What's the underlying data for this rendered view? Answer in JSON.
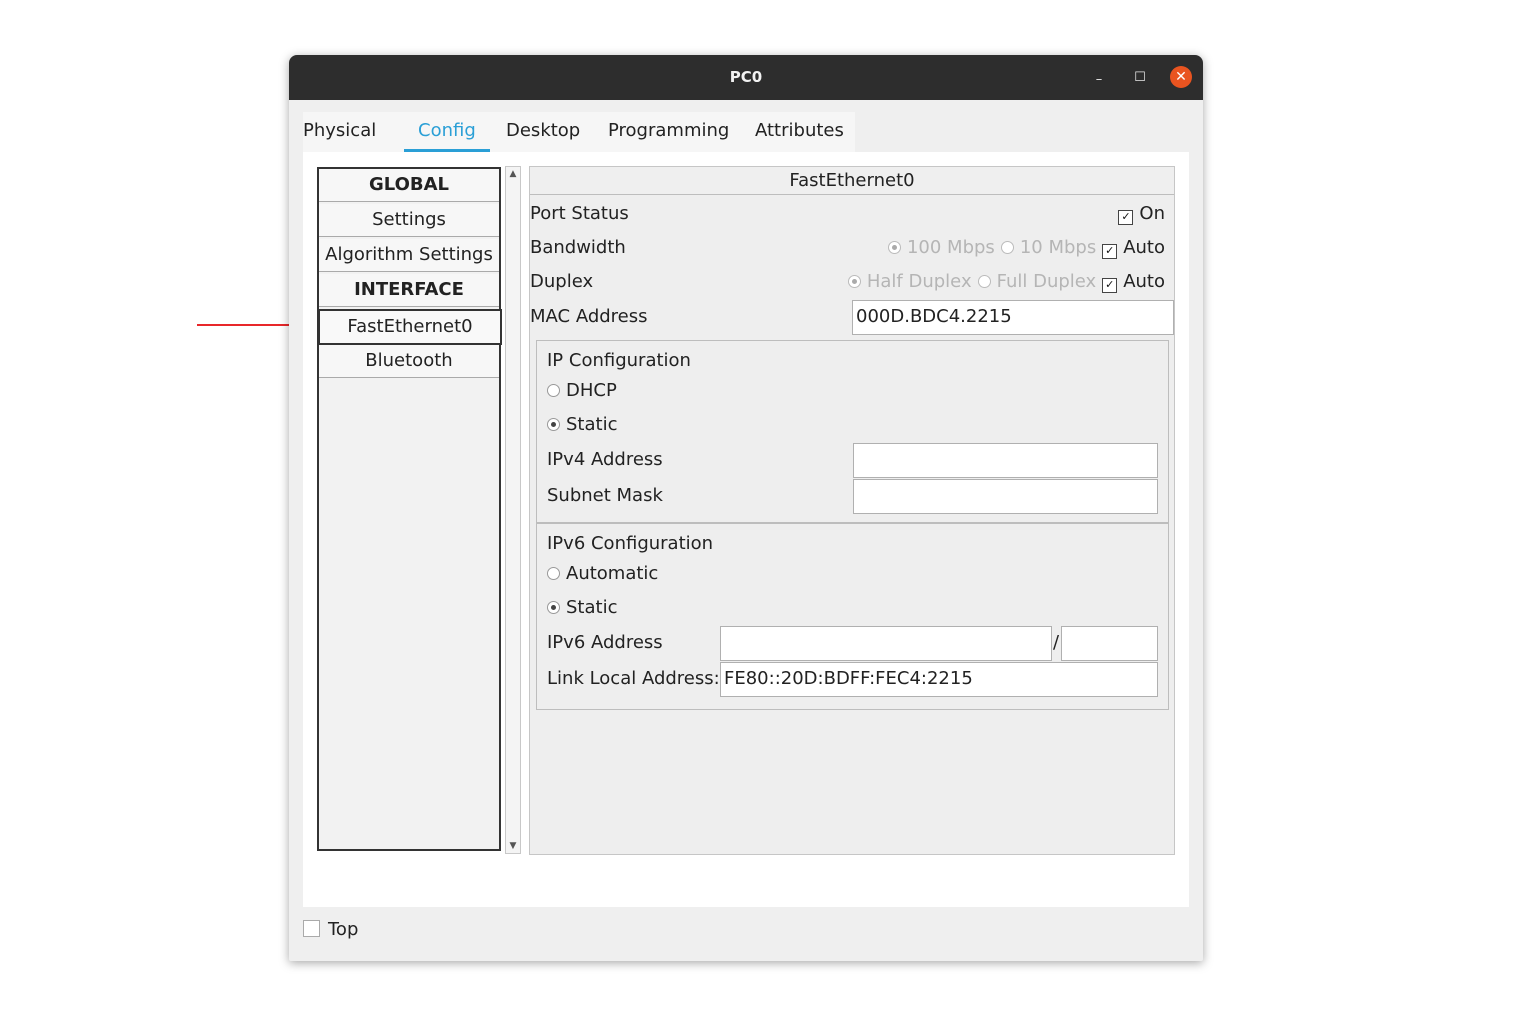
{
  "window": {
    "title": "PC0",
    "min_glyph": "–",
    "max_glyph": "☐",
    "close_glyph": "✕"
  },
  "tabs": [
    {
      "label": "Physical",
      "active": false
    },
    {
      "label": "Config",
      "active": true
    },
    {
      "label": "Desktop",
      "active": false
    },
    {
      "label": "Programming",
      "active": false
    },
    {
      "label": "Attributes",
      "active": false
    }
  ],
  "sidebar": {
    "items": [
      {
        "label": "GLOBAL",
        "type": "header"
      },
      {
        "label": "Settings",
        "type": "item"
      },
      {
        "label": "Algorithm Settings",
        "type": "item"
      },
      {
        "label": "INTERFACE",
        "type": "header"
      },
      {
        "label": "FastEthernet0",
        "type": "item",
        "selected": true
      },
      {
        "label": "Bluetooth",
        "type": "item"
      }
    ]
  },
  "panel": {
    "title": "FastEthernet0",
    "port_status": {
      "label": "Port Status",
      "on_label": "On",
      "checked": true
    },
    "bandwidth": {
      "label": "Bandwidth",
      "opt1": "100 Mbps",
      "opt2": "10 Mbps",
      "auto": "Auto",
      "auto_checked": true
    },
    "duplex": {
      "label": "Duplex",
      "opt1": "Half Duplex",
      "opt2": "Full Duplex",
      "auto": "Auto",
      "auto_checked": true
    },
    "mac": {
      "label": "MAC Address",
      "value": "000D.BDC4.2215"
    },
    "ip_config": {
      "title": "IP Configuration",
      "dhcp": "DHCP",
      "static": "Static",
      "ipv4_label": "IPv4 Address",
      "ipv4_value": "",
      "mask_label": "Subnet Mask",
      "mask_value": ""
    },
    "ipv6_config": {
      "title": "IPv6 Configuration",
      "automatic": "Automatic",
      "static": "Static",
      "ipv6_label": "IPv6 Address",
      "ipv6_value": "",
      "slash": "/",
      "prefix_value": "",
      "link_local_label": "Link Local Address:",
      "link_local_value": "FE80::20D:BDFF:FEC4:2215"
    }
  },
  "bottom": {
    "top_label": "Top",
    "checked": false
  },
  "colors": {
    "accent": "#2a9fd6",
    "titlebar": "#2d2d2d",
    "close": "#e95420",
    "arrow": "#e8272a"
  }
}
